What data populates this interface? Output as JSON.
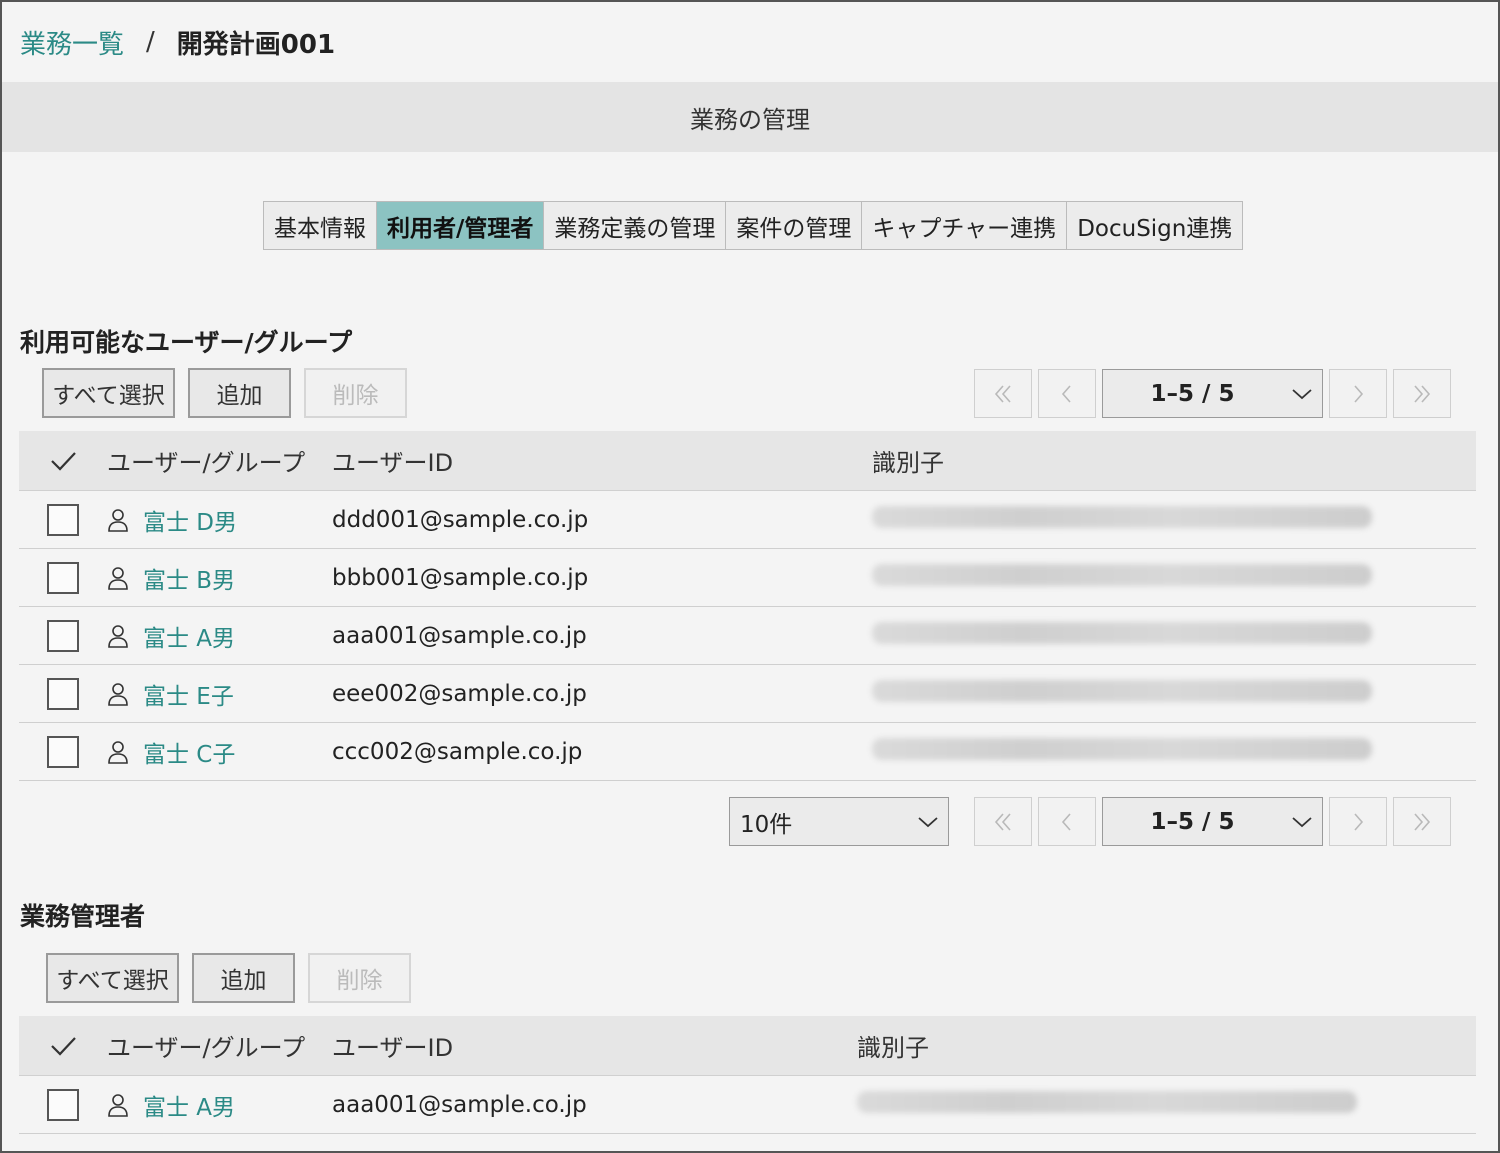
{
  "breadcrumb": {
    "parent": "業務一覧",
    "separator": "/",
    "current": "開発計画001"
  },
  "page_title": "業務の管理",
  "tabs": [
    {
      "label": "基本情報",
      "active": false
    },
    {
      "label": "利用者/管理者",
      "active": true
    },
    {
      "label": "業務定義の管理",
      "active": false
    },
    {
      "label": "案件の管理",
      "active": false
    },
    {
      "label": "キャプチャー連携",
      "active": false
    },
    {
      "label": "DocuSign連携",
      "active": false
    }
  ],
  "available": {
    "title": "利用可能なユーザー/グループ",
    "buttons": {
      "select_all": "すべて選択",
      "add": "追加",
      "delete": "削除"
    },
    "pager_top": {
      "range": "1–5 / 5"
    },
    "columns": {
      "user_group": "ユーザー/グループ",
      "user_id": "ユーザーID",
      "identifier": "識別子"
    },
    "rows": [
      {
        "name": "富士 D男",
        "user_id": "ddd001@sample.co.jp"
      },
      {
        "name": "富士 B男",
        "user_id": "bbb001@sample.co.jp"
      },
      {
        "name": "富士 A男",
        "user_id": "aaa001@sample.co.jp"
      },
      {
        "name": "富士 E子",
        "user_id": "eee002@sample.co.jp"
      },
      {
        "name": "富士 C子",
        "user_id": "ccc002@sample.co.jp"
      }
    ],
    "per_page": "10件",
    "pager_bottom": {
      "range": "1–5 / 5"
    }
  },
  "admins": {
    "title": "業務管理者",
    "buttons": {
      "select_all": "すべて選択",
      "add": "追加",
      "delete": "削除"
    },
    "columns": {
      "user_group": "ユーザー/グループ",
      "user_id": "ユーザーID",
      "identifier": "識別子"
    },
    "rows": [
      {
        "name": "富士 A男",
        "user_id": "aaa001@sample.co.jp"
      }
    ]
  },
  "colors": {
    "accent": "#2b8a86",
    "active_tab": "#8cc3c2"
  },
  "icons": {
    "user": "user-icon",
    "check": "check-icon",
    "first": "first-page-icon",
    "prev": "prev-page-icon",
    "next": "next-page-icon",
    "last": "last-page-icon",
    "dropdown": "chevron-down-icon"
  }
}
